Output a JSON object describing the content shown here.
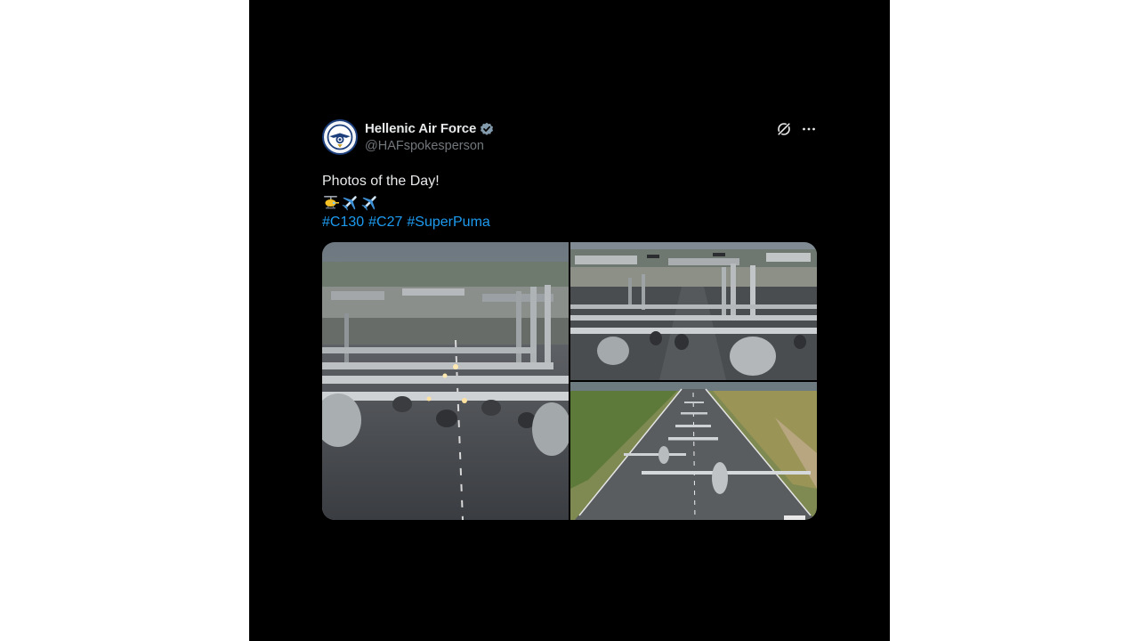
{
  "tweet": {
    "author": {
      "display_name": "Hellenic Air Force",
      "handle": "@HAFspokesperson",
      "verified": true,
      "avatar_icon": "hellenic-air-force-emblem"
    },
    "actions": {
      "grok_icon": "grok-icon",
      "more_icon": "more-options-icon"
    },
    "text": "Photos of the Day!",
    "emojis": [
      "helicopter-emoji",
      "airplane-emoji",
      "airplane-emoji"
    ],
    "hashtags": [
      "#C130",
      "#C27",
      "#SuperPuma"
    ],
    "media": [
      {
        "icon": "photo-c130-elephant-walk-closeup"
      },
      {
        "icon": "photo-c130-lineup-runway"
      },
      {
        "icon": "photo-aerial-runway-lineup"
      }
    ]
  },
  "colors": {
    "background": "#000000",
    "text": "#e7e9ea",
    "secondary_text": "#71767b",
    "link": "#1d9bf0",
    "verified_badge": "#829aab"
  }
}
